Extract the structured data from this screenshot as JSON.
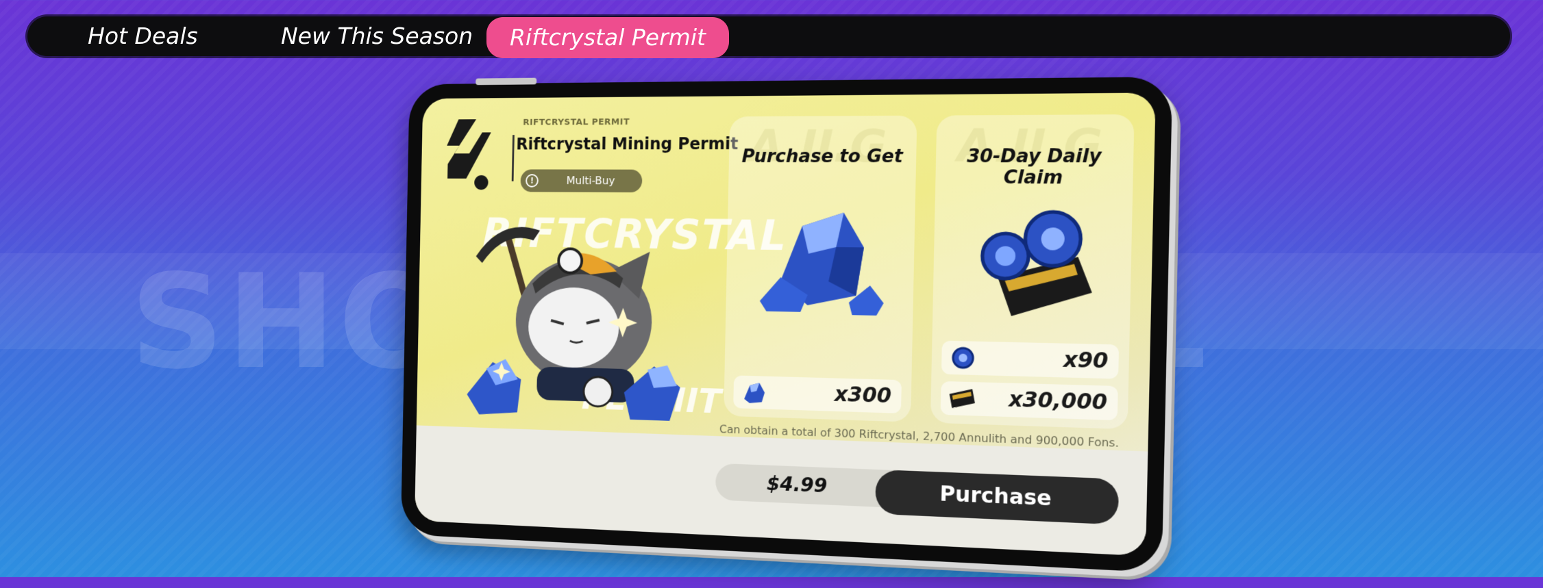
{
  "tabs": [
    {
      "label": "Hot Deals",
      "active": false
    },
    {
      "label": "New This Season",
      "active": false
    },
    {
      "label": "Riftcrystal Permit",
      "active": true
    }
  ],
  "background": {
    "watermark_left": "SHO",
    "watermark_right": "L"
  },
  "panel": {
    "category": "RIFTCRYSTAL PERMIT",
    "title": "Riftcrystal Mining Permit",
    "badge": "Multi-Buy",
    "art_word_top": "RIFTCRYSTAL",
    "art_word_bottom": "PERMIT"
  },
  "cards": [
    {
      "title": "Purchase to Get",
      "rewards": [
        {
          "icon": "riftcrystal-icon",
          "amount": "x300"
        }
      ]
    },
    {
      "title": "30-Day Daily Claim",
      "rewards": [
        {
          "icon": "annulith-icon",
          "amount": "x90"
        },
        {
          "icon": "fons-ticket-icon",
          "amount": "x30,000"
        }
      ]
    }
  ],
  "description": "Can obtain a total of 300 Riftcrystal, 2,700 Annulith and 900,000 Fons.",
  "price": "$4.99",
  "purchase_label": "Purchase",
  "colors": {
    "active_tab": "#ee4d8e",
    "tabbar": "#0d0d0f",
    "screen_yellow": "#f0eb8a",
    "purchase_button": "#2a2a2a"
  }
}
